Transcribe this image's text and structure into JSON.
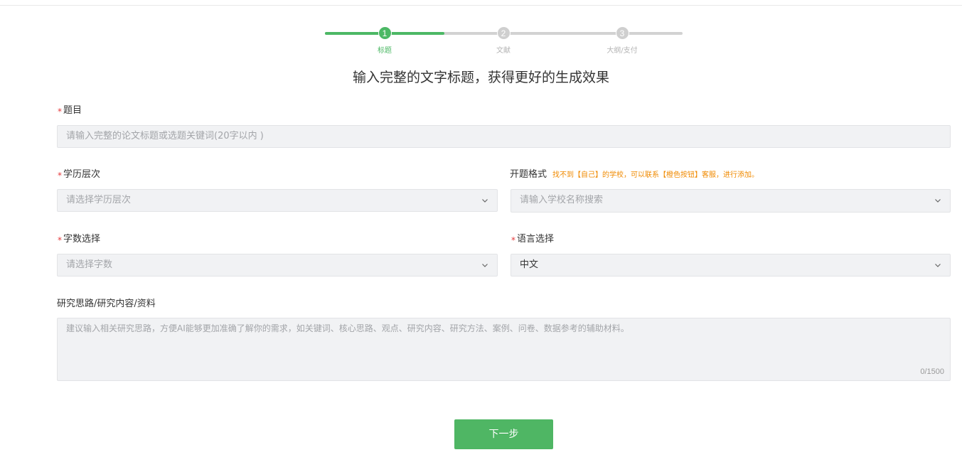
{
  "steps": [
    {
      "number": "1",
      "label": "标题",
      "active": true
    },
    {
      "number": "2",
      "label": "文献",
      "active": false
    },
    {
      "number": "3",
      "label": "大纲/支付",
      "active": false
    }
  ],
  "headline": "输入完整的文字标题，获得更好的生成效果",
  "form": {
    "required_mark": "*",
    "title": {
      "label": "题目",
      "placeholder": "请输入完整的论文标题或选题关键词(20字以内 )"
    },
    "education": {
      "label": "学历层次",
      "placeholder": "请选择学历层次"
    },
    "format": {
      "label": "开题格式",
      "note": "找不到【自己】的学校，可以联系【橙色按钮】客服，进行添加。",
      "placeholder": "请输入学校名称搜索"
    },
    "word_count": {
      "label": "字数选择",
      "placeholder": "请选择字数"
    },
    "language": {
      "label": "语言选择",
      "value": "中文"
    },
    "research": {
      "label": "研究思路/研究内容/资料",
      "placeholder": "建议输入相关研究思路，方便AI能够更加准确了解你的需求，如关键词、核心思路、观点、研究内容、研究方法、案例、问卷、数据参考的辅助材料。",
      "counter": "0/1500"
    }
  },
  "next_button": "下一步",
  "colors": {
    "accent": "#4cb865",
    "required": "#e4393c",
    "note": "#f08a00"
  }
}
